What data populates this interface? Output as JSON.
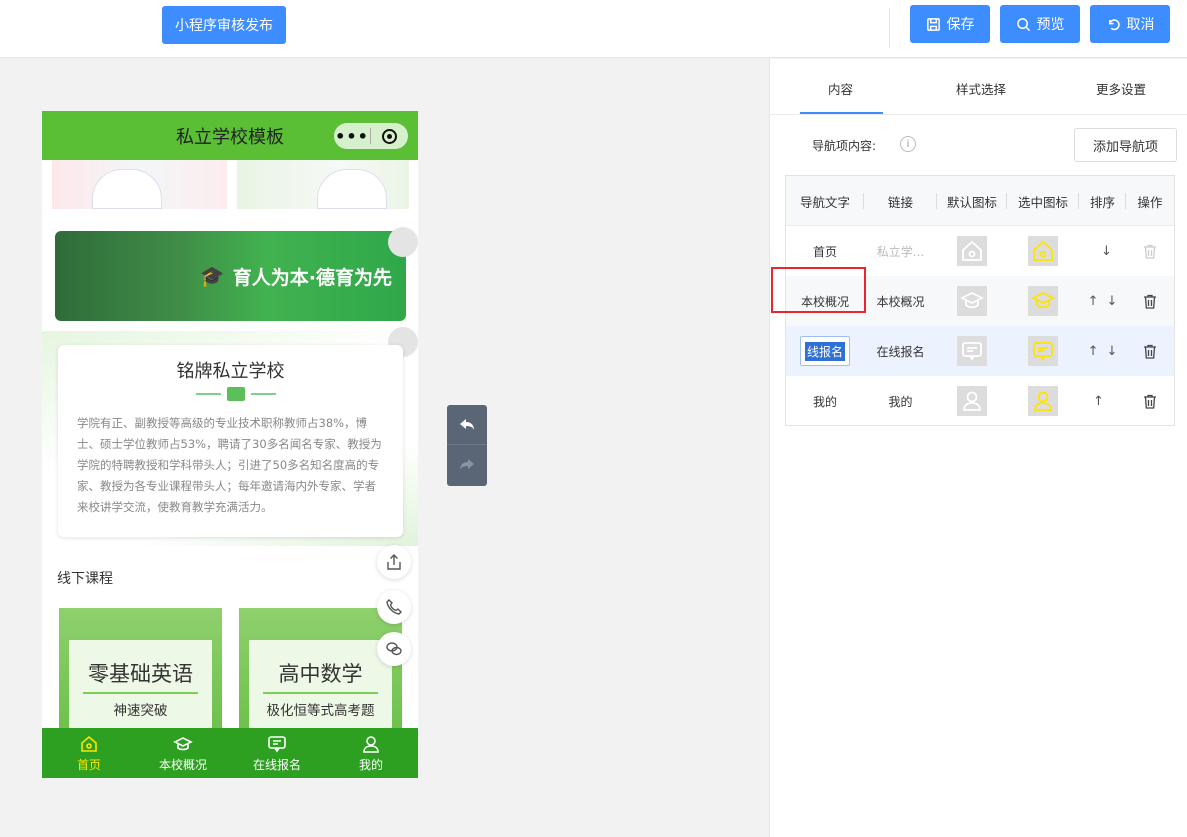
{
  "topbar": {
    "publish_label": "小程序审核发布",
    "save_label": "保存",
    "preview_label": "预览",
    "cancel_label": "取消"
  },
  "phone": {
    "title": "私立学校模板",
    "banner_text": "育人为本·德育为先",
    "intro": {
      "title": "铭牌私立学校",
      "body": "学院有正、副教授等高级的专业技术职称教师占38%，博士、硕士学位教师占53%，聘请了30多名闻名专家、教授为学院的特聘教授和学科带头人；引进了50多名知名度高的专家、教授为各专业课程带头人；每年邀请海内外专家、学者来校讲学交流，使教育教学充满活力。"
    },
    "courses_title": "线下课程",
    "courses": [
      {
        "title": "零基础英语",
        "subtitle": "神速突破"
      },
      {
        "title": "高中数学",
        "subtitle": "极化恒等式高考题"
      }
    ],
    "tabbar": [
      {
        "label": "首页",
        "icon": "home-icon",
        "active": true
      },
      {
        "label": "本校概况",
        "icon": "graduation-cap-icon",
        "active": false
      },
      {
        "label": "在线报名",
        "icon": "message-icon",
        "active": false
      },
      {
        "label": "我的",
        "icon": "user-icon",
        "active": false
      }
    ],
    "colors": {
      "header": "#5bbf36",
      "tabbar": "#2da022",
      "active_tab": "#ffe400"
    }
  },
  "panel": {
    "tabs": [
      "内容",
      "样式选择",
      "更多设置"
    ],
    "active_tab": "内容",
    "nav_label": "导航项内容:",
    "info_icon": "i",
    "add_button": "添加导航项",
    "table": {
      "headers": [
        "导航文字",
        "链接",
        "默认图标",
        "选中图标",
        "排序",
        "操作"
      ],
      "rows": [
        {
          "text": "首页",
          "link": "私立学...",
          "icon": "home-icon",
          "sort_up": "",
          "sort_down": "↓"
        },
        {
          "text": "本校概况",
          "link": "本校概况",
          "icon": "graduation-cap-icon",
          "sort_up": "↑",
          "sort_down": "↓"
        },
        {
          "text": "线报名",
          "link": "在线报名",
          "icon": "message-icon",
          "sort_up": "↑",
          "sort_down": "↓"
        },
        {
          "text": "我的",
          "link": "我的",
          "icon": "user-icon",
          "sort_up": "↑",
          "sort_down": ""
        }
      ]
    },
    "accent": "#3d8dff"
  }
}
